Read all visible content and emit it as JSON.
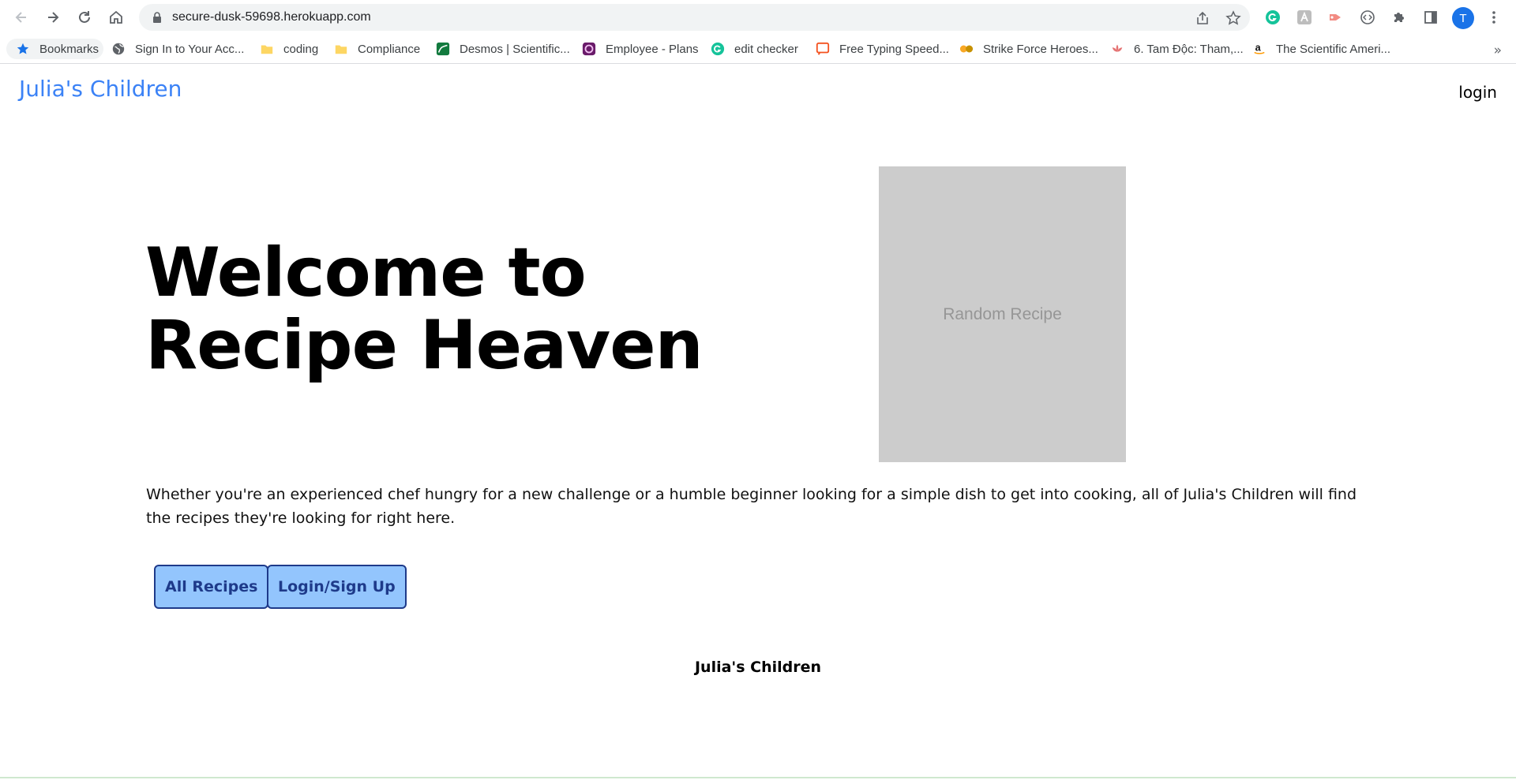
{
  "browser": {
    "url": "secure-dusk-59698.herokuapp.com",
    "profile_initial": "T",
    "bookmarks": [
      {
        "label": "Bookmarks",
        "icon": "star-icon"
      },
      {
        "label": "Sign In to Your Acc...",
        "icon": "globe-icon"
      },
      {
        "label": "coding",
        "icon": "folder-icon"
      },
      {
        "label": "Compliance",
        "icon": "folder-icon"
      },
      {
        "label": "Desmos | Scientific...",
        "icon": "desmos-icon"
      },
      {
        "label": "Employee - Plans",
        "icon": "employee-plans-icon"
      },
      {
        "label": "edit checker",
        "icon": "grammarly-icon"
      },
      {
        "label": "Free Typing Speed...",
        "icon": "typing-test-icon"
      },
      {
        "label": "Strike Force Heroes...",
        "icon": "game-icon"
      },
      {
        "label": "6. Tam Độc: Tham,...",
        "icon": "lotus-icon"
      },
      {
        "label": "The Scientific Ameri...",
        "icon": "amazon-icon"
      }
    ],
    "more_label": "»"
  },
  "site": {
    "brand": "Julia's Children",
    "login_link": "login",
    "hero_line1": "Welcome to",
    "hero_line2": "Recipe Heaven",
    "random_recipe": "Random Recipe",
    "intro": "Whether you're an experienced chef hungry for a new challenge or a humble beginner looking for a simple dish to get into cooking, all of Julia's Children will find the recipes they're looking for right here.",
    "buttons": {
      "all_recipes": "All Recipes",
      "login_signup": "Login/Sign Up"
    },
    "footer": "Julia's Children"
  },
  "colors": {
    "brand": "#3b82f6",
    "button_bg": "#93c5fd",
    "button_border": "#1e3a8a",
    "placeholder_bg": "#cccccc"
  }
}
